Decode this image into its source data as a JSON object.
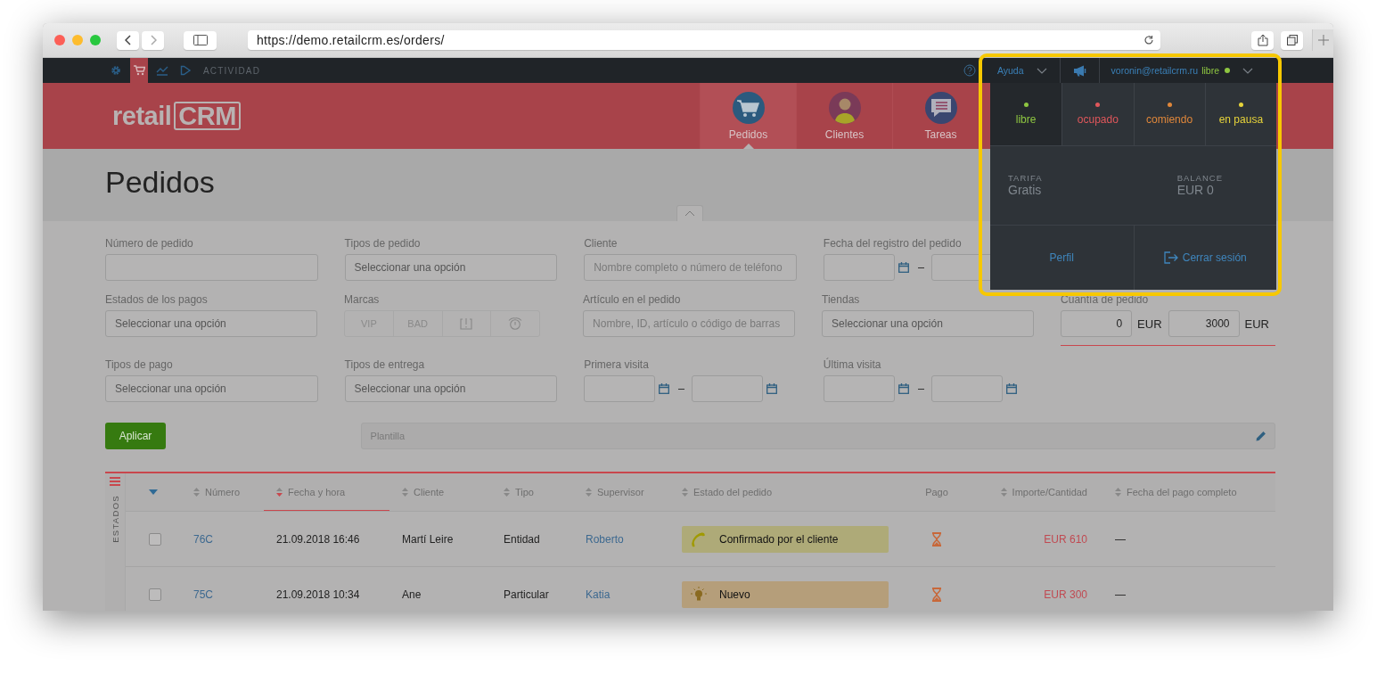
{
  "browser": {
    "url": "https://demo.retailcrm.es/orders/"
  },
  "topbar": {
    "icons": [
      {
        "kind": "gear",
        "selected": false
      },
      {
        "kind": "cart",
        "selected": true
      },
      {
        "kind": "chart",
        "selected": false
      },
      {
        "kind": "play",
        "selected": false
      }
    ],
    "activity": "ACTIVIDAD",
    "help": "Ayuda",
    "user_email": "voronin@retailcrm.ru",
    "user_status": "libre"
  },
  "header": {
    "logo": {
      "text": "retail",
      "mark": "CRM"
    },
    "tabs": [
      {
        "label": "Pedidos",
        "kind": "cart",
        "selected": true
      },
      {
        "label": "Clientes",
        "kind": "person",
        "selected": false
      },
      {
        "label": "Tareas",
        "kind": "chat",
        "selected": false
      }
    ]
  },
  "page_title": "Pedidos",
  "filter_rows": [
    {
      "fields": [
        {
          "label": "Número de pedido",
          "kind": "text"
        },
        {
          "label": "Tipos de pedido",
          "kind": "select",
          "value": "Seleccionar una opción"
        },
        {
          "label": "Cliente",
          "kind": "text",
          "placeholder": "Nombre completo o número de teléfono"
        },
        {
          "label": "Fecha del registro del pedido",
          "kind": "date_range"
        }
      ]
    },
    {
      "fields": [
        {
          "label": "Estados de los pagos",
          "kind": "select",
          "value": "Seleccionar una opción"
        },
        {
          "label": "Marcas",
          "kind": "tags",
          "tags": [
            {
              "kind": "text",
              "label": "VIP",
              "selected": false
            },
            {
              "kind": "text",
              "label": "BAD",
              "selected": false
            },
            {
              "kind": "flag",
              "selected": false
            },
            {
              "kind": "clock",
              "selected": false
            }
          ]
        },
        {
          "label": "Artículo en el pedido",
          "kind": "text",
          "placeholder": "Nombre, ID, artículo o código de barras"
        },
        {
          "label": "Tiendas",
          "kind": "select",
          "value": "Seleccionar una opción"
        },
        {
          "label": "Cuantía de pedido",
          "kind": "amount_range",
          "from": "0",
          "currency_1": "EUR",
          "to": "3000",
          "currency_2": "EUR"
        }
      ]
    },
    {
      "fields": [
        {
          "label": "Tipos de pago",
          "kind": "select",
          "value": "Seleccionar una opción"
        },
        {
          "label": "Tipos de entrega",
          "kind": "select",
          "value": "Seleccionar una opción"
        },
        {
          "label": "Primera visita",
          "kind": "date_range"
        },
        {
          "label": "Última visita",
          "kind": "date_range"
        }
      ]
    }
  ],
  "apply_button": "Aplicar",
  "template": {
    "placeholder": "Plantilla"
  },
  "table": {
    "side_label": "ESTADOS",
    "columns": [
      {
        "label": "Número",
        "sortable": true,
        "selected": false
      },
      {
        "label": "Fecha y hora",
        "sortable": true,
        "selected": true
      },
      {
        "label": "Cliente",
        "sortable": true,
        "selected": false
      },
      {
        "label": "Tipo",
        "sortable": true,
        "selected": false
      },
      {
        "label": "Supervisor",
        "sortable": true,
        "selected": false
      },
      {
        "label": "Estado del pedido",
        "sortable": true,
        "selected": false
      },
      {
        "label": "Pago",
        "sortable": false,
        "selected": false
      },
      {
        "label": "Importe/Cantidad",
        "sortable": true,
        "selected": false
      },
      {
        "label": "Fecha del pago completo",
        "sortable": true,
        "selected": false
      }
    ],
    "rows": [
      {
        "checked": false,
        "number": "76C",
        "date": "21.09.2018 16:46",
        "client": "Martí Leire",
        "type": "Entidad",
        "supervisor": "Roberto",
        "status": {
          "label": "Confirmado por el cliente",
          "kind": "phone",
          "color": "#aeaa78"
        },
        "payment": {
          "kind": "hourglass"
        },
        "amount": "EUR 610",
        "paid_date": "—"
      },
      {
        "checked": false,
        "number": "75C",
        "date": "21.09.2018 10:34",
        "client": "Ane",
        "type": "Particular",
        "supervisor": "Katia",
        "status": {
          "label": "Nuevo",
          "kind": "bulb",
          "color": "#b59e7a"
        },
        "payment": {
          "kind": "hourglass"
        },
        "amount": "EUR 300",
        "paid_date": "—"
      }
    ]
  },
  "user_menu": {
    "statuses": [
      {
        "label": "libre",
        "color": "#8ec641",
        "selected": true
      },
      {
        "label": "ocupado",
        "color": "#e0575b",
        "selected": false
      },
      {
        "label": "comiendo",
        "color": "#e0873a",
        "selected": false
      },
      {
        "label": "en pausa",
        "color": "#e6d33a",
        "selected": false
      }
    ],
    "tariff_label": "TARIFA",
    "tariff": "Gratis",
    "balance_label": "BALANCE",
    "balance": "EUR 0",
    "profile": "Perfil",
    "logout": "Cerrar sesión"
  }
}
